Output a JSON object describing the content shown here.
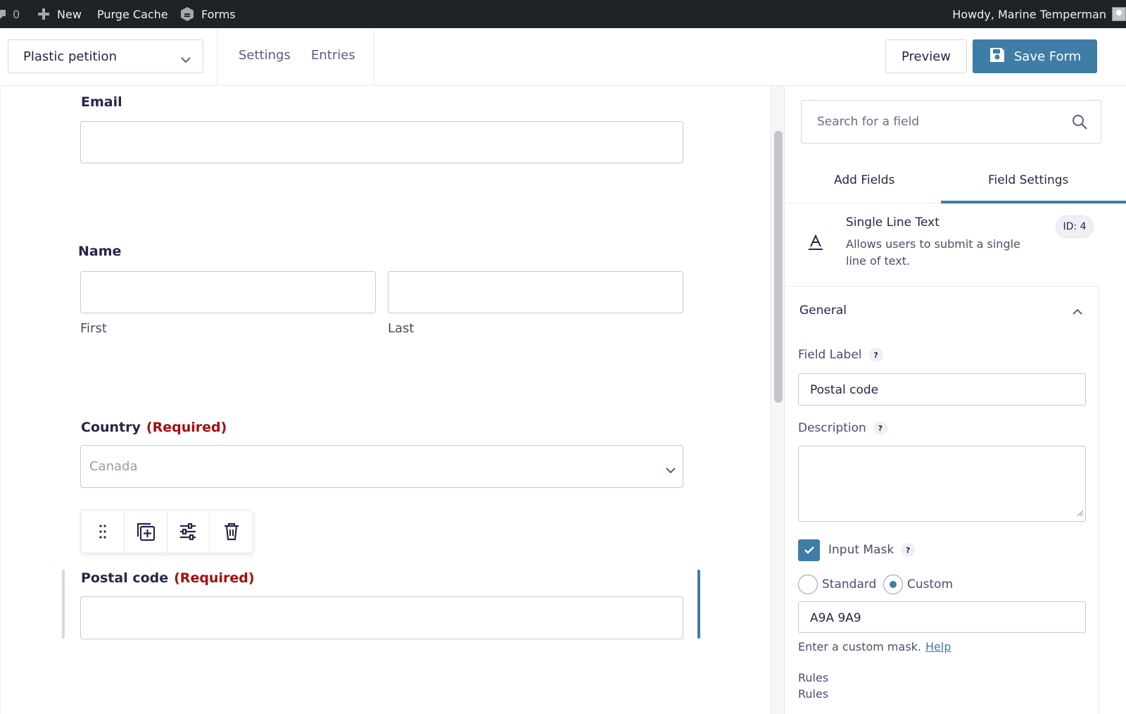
{
  "adminbar": {
    "comments_count": "0",
    "new_label": "New",
    "purge_label": "Purge Cache",
    "forms_label": "Forms",
    "howdy": "Howdy, Marine Temperman"
  },
  "toolbar": {
    "form_name": "Plastic petition",
    "settings_label": "Settings",
    "entries_label": "Entries",
    "preview_label": "Preview",
    "save_label": "Save Form"
  },
  "canvas": {
    "email": {
      "label": "Email"
    },
    "name": {
      "label": "Name",
      "first": "First",
      "last": "Last"
    },
    "country": {
      "label": "Country",
      "required": "(Required)",
      "value": "Canada"
    },
    "postal": {
      "label": "Postal code",
      "required": "(Required)"
    }
  },
  "sidebar": {
    "search_placeholder": "Search for a field",
    "tabs": [
      {
        "label": "Add Fields",
        "active": false
      },
      {
        "label": "Field Settings",
        "active": true
      }
    ],
    "field_type": {
      "title": "Single Line Text",
      "description": "Allows users to submit a single line of text.",
      "id_badge": "ID: 4"
    },
    "general": {
      "title": "General",
      "field_label_title": "Field Label",
      "field_label_value": "Postal code",
      "description_title": "Description",
      "description_value": "",
      "input_mask_label": "Input Mask",
      "input_mask_checked": true,
      "radio_standard": "Standard",
      "radio_custom": "Custom",
      "mask_value": "A9A 9A9",
      "help_text": "Enter a custom mask.",
      "help_link": "Help",
      "rules_1": "Rules",
      "rules_2": "Rules"
    }
  },
  "colors": {
    "accent": "#3e7da6",
    "required": "#a50d0d",
    "adminbar": "#1d2327"
  }
}
